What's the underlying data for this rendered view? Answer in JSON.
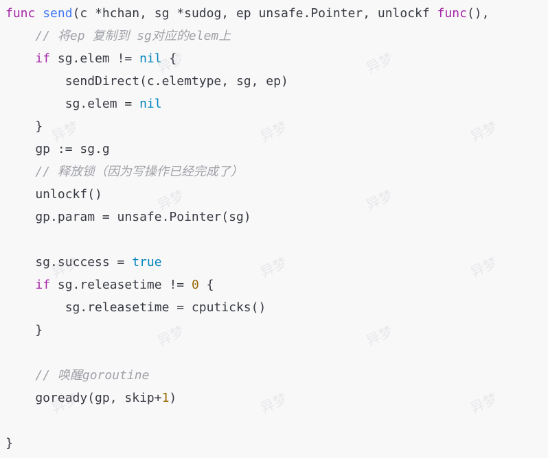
{
  "code": {
    "lines": [
      [
        {
          "t": "func",
          "c": "kw-func"
        },
        {
          "t": " "
        },
        {
          "t": "send",
          "c": "fn-name"
        },
        {
          "t": "(c *hchan, sg *sudog, ep unsafe.Pointer, unlockf "
        },
        {
          "t": "func",
          "c": "kw-func"
        },
        {
          "t": "(),"
        }
      ],
      [
        {
          "t": "    "
        },
        {
          "t": "// 将ep 复制到 sg对应的elem上",
          "c": "comment"
        }
      ],
      [
        {
          "t": "    "
        },
        {
          "t": "if",
          "c": "kw-if"
        },
        {
          "t": " sg.elem != "
        },
        {
          "t": "nil",
          "c": "kw-nil"
        },
        {
          "t": " {"
        }
      ],
      [
        {
          "t": "        sendDirect(c.elemtype, sg, ep)"
        }
      ],
      [
        {
          "t": "        sg.elem = "
        },
        {
          "t": "nil",
          "c": "kw-nil"
        }
      ],
      [
        {
          "t": "    }"
        }
      ],
      [
        {
          "t": "    gp := sg.g"
        }
      ],
      [
        {
          "t": "    "
        },
        {
          "t": "// 释放锁（因为写操作已经完成了）",
          "c": "comment"
        }
      ],
      [
        {
          "t": "    unlockf()"
        }
      ],
      [
        {
          "t": "    gp.param = unsafe.Pointer(sg)"
        }
      ],
      [
        {
          "t": ""
        }
      ],
      [
        {
          "t": "    sg.success = "
        },
        {
          "t": "true",
          "c": "kw-true"
        }
      ],
      [
        {
          "t": "    "
        },
        {
          "t": "if",
          "c": "kw-if"
        },
        {
          "t": " sg.releasetime != "
        },
        {
          "t": "0",
          "c": "num"
        },
        {
          "t": " {"
        }
      ],
      [
        {
          "t": "        sg.releasetime = cputicks()"
        }
      ],
      [
        {
          "t": "    }"
        }
      ],
      [
        {
          "t": ""
        }
      ],
      [
        {
          "t": "    "
        },
        {
          "t": "// 唤醒goroutine",
          "c": "comment"
        }
      ],
      [
        {
          "t": "    goready(gp, skip+"
        },
        {
          "t": "1",
          "c": "num"
        },
        {
          "t": ")"
        }
      ],
      [
        {
          "t": ""
        }
      ],
      [
        {
          "t": "}"
        }
      ]
    ]
  },
  "watermark": {
    "text": "异梦"
  },
  "colors": {
    "background": "#f8f8f9",
    "keyword": "#a626a4",
    "function": "#4078f2",
    "constant": "#0184bc",
    "number": "#986801",
    "comment": "#a0a1a7",
    "text": "#383a42"
  }
}
